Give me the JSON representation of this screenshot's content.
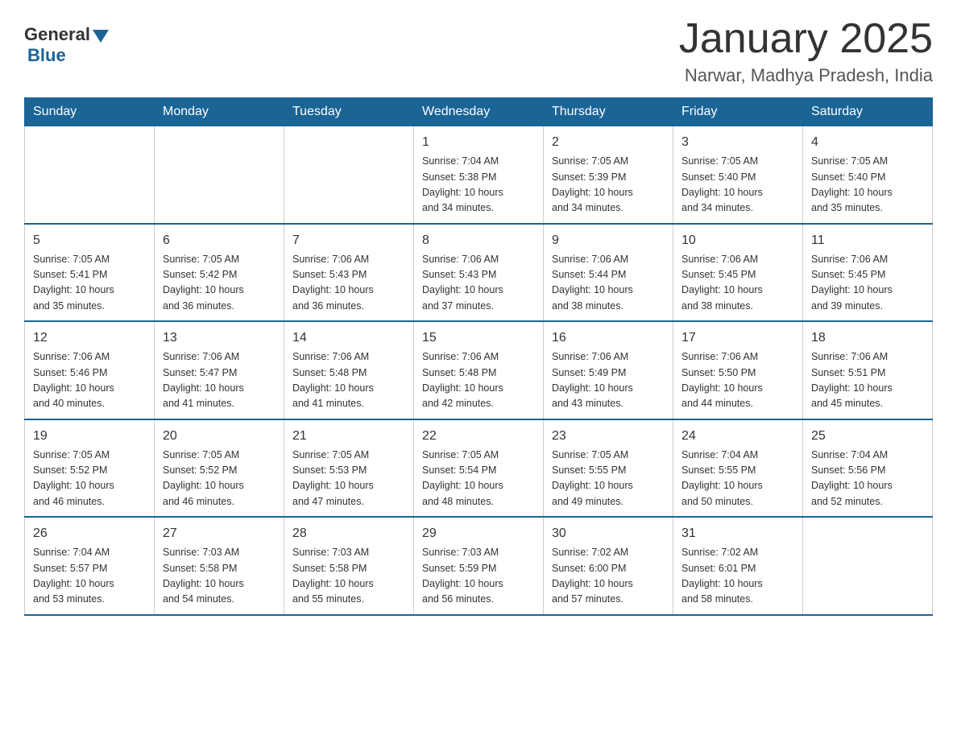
{
  "logo": {
    "general": "General",
    "blue": "Blue"
  },
  "title": "January 2025",
  "location": "Narwar, Madhya Pradesh, India",
  "days_header": [
    "Sunday",
    "Monday",
    "Tuesday",
    "Wednesday",
    "Thursday",
    "Friday",
    "Saturday"
  ],
  "weeks": [
    [
      {
        "day": "",
        "info": ""
      },
      {
        "day": "",
        "info": ""
      },
      {
        "day": "",
        "info": ""
      },
      {
        "day": "1",
        "info": "Sunrise: 7:04 AM\nSunset: 5:38 PM\nDaylight: 10 hours\nand 34 minutes."
      },
      {
        "day": "2",
        "info": "Sunrise: 7:05 AM\nSunset: 5:39 PM\nDaylight: 10 hours\nand 34 minutes."
      },
      {
        "day": "3",
        "info": "Sunrise: 7:05 AM\nSunset: 5:40 PM\nDaylight: 10 hours\nand 34 minutes."
      },
      {
        "day": "4",
        "info": "Sunrise: 7:05 AM\nSunset: 5:40 PM\nDaylight: 10 hours\nand 35 minutes."
      }
    ],
    [
      {
        "day": "5",
        "info": "Sunrise: 7:05 AM\nSunset: 5:41 PM\nDaylight: 10 hours\nand 35 minutes."
      },
      {
        "day": "6",
        "info": "Sunrise: 7:05 AM\nSunset: 5:42 PM\nDaylight: 10 hours\nand 36 minutes."
      },
      {
        "day": "7",
        "info": "Sunrise: 7:06 AM\nSunset: 5:43 PM\nDaylight: 10 hours\nand 36 minutes."
      },
      {
        "day": "8",
        "info": "Sunrise: 7:06 AM\nSunset: 5:43 PM\nDaylight: 10 hours\nand 37 minutes."
      },
      {
        "day": "9",
        "info": "Sunrise: 7:06 AM\nSunset: 5:44 PM\nDaylight: 10 hours\nand 38 minutes."
      },
      {
        "day": "10",
        "info": "Sunrise: 7:06 AM\nSunset: 5:45 PM\nDaylight: 10 hours\nand 38 minutes."
      },
      {
        "day": "11",
        "info": "Sunrise: 7:06 AM\nSunset: 5:45 PM\nDaylight: 10 hours\nand 39 minutes."
      }
    ],
    [
      {
        "day": "12",
        "info": "Sunrise: 7:06 AM\nSunset: 5:46 PM\nDaylight: 10 hours\nand 40 minutes."
      },
      {
        "day": "13",
        "info": "Sunrise: 7:06 AM\nSunset: 5:47 PM\nDaylight: 10 hours\nand 41 minutes."
      },
      {
        "day": "14",
        "info": "Sunrise: 7:06 AM\nSunset: 5:48 PM\nDaylight: 10 hours\nand 41 minutes."
      },
      {
        "day": "15",
        "info": "Sunrise: 7:06 AM\nSunset: 5:48 PM\nDaylight: 10 hours\nand 42 minutes."
      },
      {
        "day": "16",
        "info": "Sunrise: 7:06 AM\nSunset: 5:49 PM\nDaylight: 10 hours\nand 43 minutes."
      },
      {
        "day": "17",
        "info": "Sunrise: 7:06 AM\nSunset: 5:50 PM\nDaylight: 10 hours\nand 44 minutes."
      },
      {
        "day": "18",
        "info": "Sunrise: 7:06 AM\nSunset: 5:51 PM\nDaylight: 10 hours\nand 45 minutes."
      }
    ],
    [
      {
        "day": "19",
        "info": "Sunrise: 7:05 AM\nSunset: 5:52 PM\nDaylight: 10 hours\nand 46 minutes."
      },
      {
        "day": "20",
        "info": "Sunrise: 7:05 AM\nSunset: 5:52 PM\nDaylight: 10 hours\nand 46 minutes."
      },
      {
        "day": "21",
        "info": "Sunrise: 7:05 AM\nSunset: 5:53 PM\nDaylight: 10 hours\nand 47 minutes."
      },
      {
        "day": "22",
        "info": "Sunrise: 7:05 AM\nSunset: 5:54 PM\nDaylight: 10 hours\nand 48 minutes."
      },
      {
        "day": "23",
        "info": "Sunrise: 7:05 AM\nSunset: 5:55 PM\nDaylight: 10 hours\nand 49 minutes."
      },
      {
        "day": "24",
        "info": "Sunrise: 7:04 AM\nSunset: 5:55 PM\nDaylight: 10 hours\nand 50 minutes."
      },
      {
        "day": "25",
        "info": "Sunrise: 7:04 AM\nSunset: 5:56 PM\nDaylight: 10 hours\nand 52 minutes."
      }
    ],
    [
      {
        "day": "26",
        "info": "Sunrise: 7:04 AM\nSunset: 5:57 PM\nDaylight: 10 hours\nand 53 minutes."
      },
      {
        "day": "27",
        "info": "Sunrise: 7:03 AM\nSunset: 5:58 PM\nDaylight: 10 hours\nand 54 minutes."
      },
      {
        "day": "28",
        "info": "Sunrise: 7:03 AM\nSunset: 5:58 PM\nDaylight: 10 hours\nand 55 minutes."
      },
      {
        "day": "29",
        "info": "Sunrise: 7:03 AM\nSunset: 5:59 PM\nDaylight: 10 hours\nand 56 minutes."
      },
      {
        "day": "30",
        "info": "Sunrise: 7:02 AM\nSunset: 6:00 PM\nDaylight: 10 hours\nand 57 minutes."
      },
      {
        "day": "31",
        "info": "Sunrise: 7:02 AM\nSunset: 6:01 PM\nDaylight: 10 hours\nand 58 minutes."
      },
      {
        "day": "",
        "info": ""
      }
    ]
  ]
}
